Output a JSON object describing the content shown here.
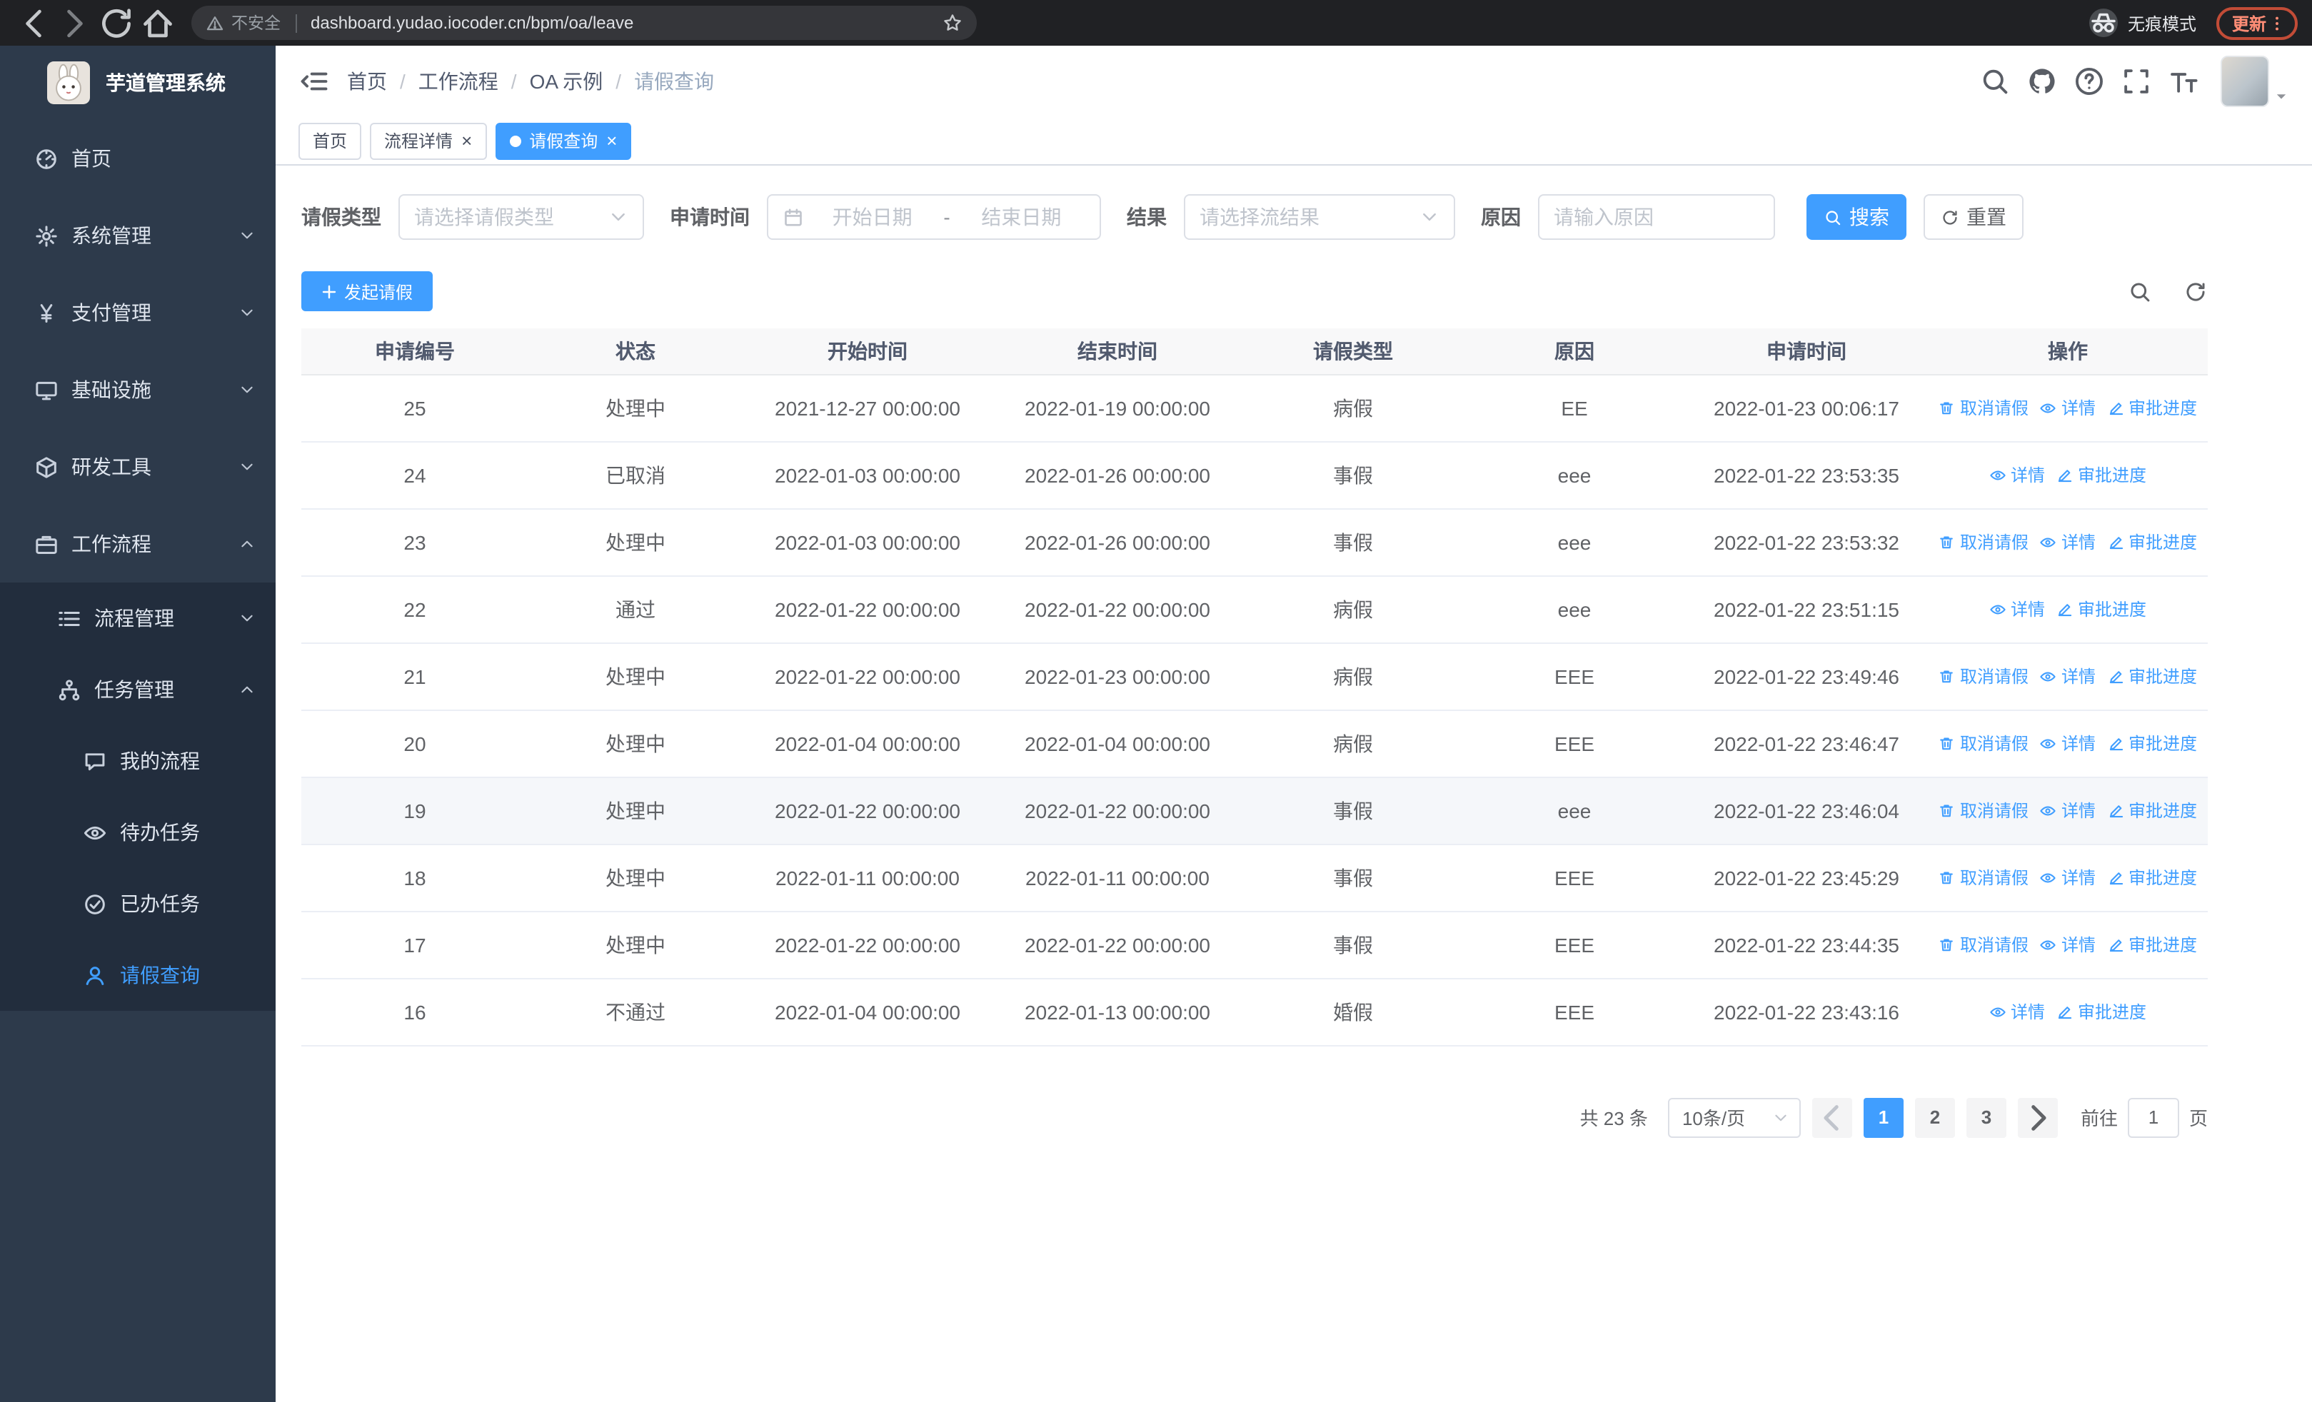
{
  "browser": {
    "security_label": "不安全",
    "url": "dashboard.yudao.iocoder.cn/bpm/oa/leave",
    "incognito_label": "无痕模式",
    "update_label": "更新"
  },
  "sidebar": {
    "logo_title": "芋道管理系统",
    "items": [
      {
        "name": "home",
        "icon": "dashboard-icon",
        "label": "首页",
        "level": 0
      },
      {
        "name": "system-management",
        "icon": "gear-icon",
        "label": "系统管理",
        "level": 0,
        "arrow": "down"
      },
      {
        "name": "payment-management",
        "icon": "yen-icon",
        "label": "支付管理",
        "level": 0,
        "arrow": "down"
      },
      {
        "name": "infrastructure",
        "icon": "monitor-icon",
        "label": "基础设施",
        "level": 0,
        "arrow": "down"
      },
      {
        "name": "dev-tools",
        "icon": "cube-icon",
        "label": "研发工具",
        "level": 0,
        "arrow": "down"
      },
      {
        "name": "workflow",
        "icon": "briefcase-icon",
        "label": "工作流程",
        "level": 0,
        "arrow": "up"
      }
    ],
    "sub_items": [
      {
        "name": "process-management",
        "icon": "list-icon",
        "label": "流程管理",
        "level": 1,
        "arrow": "down"
      },
      {
        "name": "task-management",
        "icon": "flow-icon",
        "label": "任务管理",
        "level": 1,
        "arrow": "up"
      },
      {
        "name": "my-process",
        "icon": "chat-icon",
        "label": "我的流程",
        "level": 2
      },
      {
        "name": "todo-tasks",
        "icon": "eye-icon",
        "label": "待办任务",
        "level": 2
      },
      {
        "name": "done-tasks",
        "icon": "finished-icon",
        "label": "已办任务",
        "level": 2
      },
      {
        "name": "leave-query",
        "icon": "user-icon",
        "label": "请假查询",
        "level": 2,
        "active": true
      }
    ]
  },
  "header": {
    "breadcrumb": [
      "首页",
      "工作流程",
      "OA 示例",
      "请假查询"
    ]
  },
  "tabs": [
    {
      "label": "首页",
      "closable": false,
      "active": false
    },
    {
      "label": "流程详情",
      "closable": true,
      "active": false
    },
    {
      "label": "请假查询",
      "closable": true,
      "active": true
    }
  ],
  "filters": {
    "type_label": "请假类型",
    "type_placeholder": "请选择请假类型",
    "time_label": "申请时间",
    "date_start_placeholder": "开始日期",
    "date_separator": "-",
    "date_end_placeholder": "结束日期",
    "result_label": "结果",
    "result_placeholder": "请选择流结果",
    "reason_label": "原因",
    "reason_placeholder": "请输入原因",
    "search_label": "搜索",
    "reset_label": "重置"
  },
  "toolbar": {
    "create_label": "发起请假"
  },
  "table": {
    "columns": [
      "申请编号",
      "状态",
      "开始时间",
      "结束时间",
      "请假类型",
      "原因",
      "申请时间",
      "操作"
    ],
    "op_labels": {
      "cancel": "取消请假",
      "detail": "详情",
      "progress": "审批进度"
    },
    "rows": [
      {
        "id": "25",
        "status": "处理中",
        "start": "2021-12-27 00:00:00",
        "end": "2022-01-19 00:00:00",
        "type": "病假",
        "reason": "EE",
        "applied": "2022-01-23 00:06:17",
        "cancellable": true,
        "highlight": false
      },
      {
        "id": "24",
        "status": "已取消",
        "start": "2022-01-03 00:00:00",
        "end": "2022-01-26 00:00:00",
        "type": "事假",
        "reason": "eee",
        "applied": "2022-01-22 23:53:35",
        "cancellable": false,
        "highlight": false
      },
      {
        "id": "23",
        "status": "处理中",
        "start": "2022-01-03 00:00:00",
        "end": "2022-01-26 00:00:00",
        "type": "事假",
        "reason": "eee",
        "applied": "2022-01-22 23:53:32",
        "cancellable": true,
        "highlight": false
      },
      {
        "id": "22",
        "status": "通过",
        "start": "2022-01-22 00:00:00",
        "end": "2022-01-22 00:00:00",
        "type": "病假",
        "reason": "eee",
        "applied": "2022-01-22 23:51:15",
        "cancellable": false,
        "highlight": false
      },
      {
        "id": "21",
        "status": "处理中",
        "start": "2022-01-22 00:00:00",
        "end": "2022-01-23 00:00:00",
        "type": "病假",
        "reason": "EEE",
        "applied": "2022-01-22 23:49:46",
        "cancellable": true,
        "highlight": false
      },
      {
        "id": "20",
        "status": "处理中",
        "start": "2022-01-04 00:00:00",
        "end": "2022-01-04 00:00:00",
        "type": "病假",
        "reason": "EEE",
        "applied": "2022-01-22 23:46:47",
        "cancellable": true,
        "highlight": false
      },
      {
        "id": "19",
        "status": "处理中",
        "start": "2022-01-22 00:00:00",
        "end": "2022-01-22 00:00:00",
        "type": "事假",
        "reason": "eee",
        "applied": "2022-01-22 23:46:04",
        "cancellable": true,
        "highlight": true
      },
      {
        "id": "18",
        "status": "处理中",
        "start": "2022-01-11 00:00:00",
        "end": "2022-01-11 00:00:00",
        "type": "事假",
        "reason": "EEE",
        "applied": "2022-01-22 23:45:29",
        "cancellable": true,
        "highlight": false
      },
      {
        "id": "17",
        "status": "处理中",
        "start": "2022-01-22 00:00:00",
        "end": "2022-01-22 00:00:00",
        "type": "事假",
        "reason": "EEE",
        "applied": "2022-01-22 23:44:35",
        "cancellable": true,
        "highlight": false
      },
      {
        "id": "16",
        "status": "不通过",
        "start": "2022-01-04 00:00:00",
        "end": "2022-01-13 00:00:00",
        "type": "婚假",
        "reason": "EEE",
        "applied": "2022-01-22 23:43:16",
        "cancellable": false,
        "highlight": false
      }
    ]
  },
  "pagination": {
    "total": "共 23 条",
    "page_size": "10条/页",
    "pages": [
      "1",
      "2",
      "3"
    ],
    "current": "1",
    "goto_label": "前往",
    "goto_value": "1",
    "unit_label": "页"
  },
  "colors": {
    "primary": "#409eff",
    "sidebar_bg": "#2d3a4b",
    "submenu_bg": "#222d3d"
  }
}
